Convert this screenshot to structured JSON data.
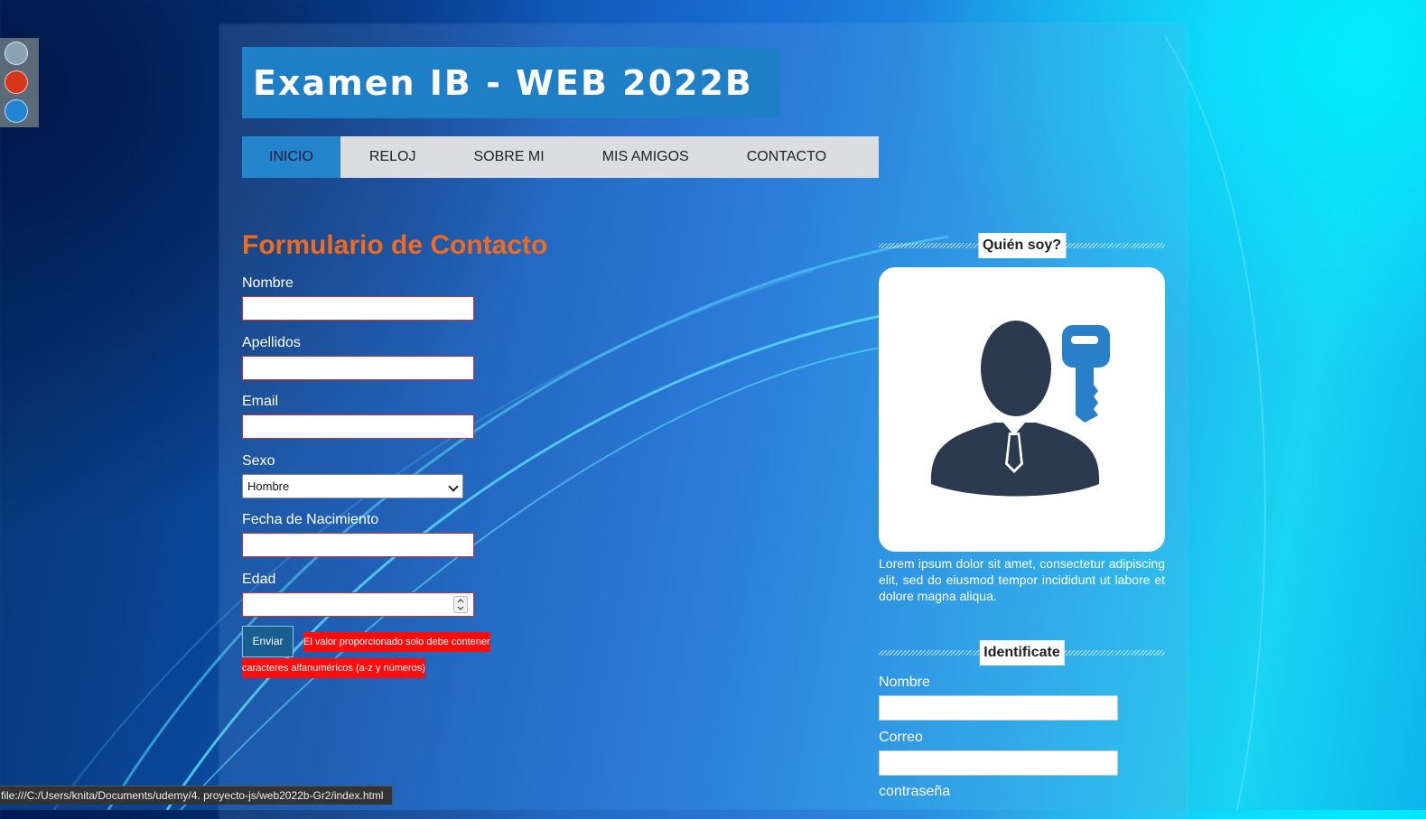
{
  "theme": {
    "dots": [
      {
        "name": "gray",
        "color": "#8aa4b6"
      },
      {
        "name": "red",
        "color": "#d6361a"
      },
      {
        "name": "blue",
        "color": "#2186d1"
      }
    ]
  },
  "header": {
    "title": "Examen IB - WEB 2022B"
  },
  "nav": {
    "items": [
      {
        "label": "INICIO",
        "active": true
      },
      {
        "label": "RELOJ",
        "active": false
      },
      {
        "label": "SOBRE MI",
        "active": false
      },
      {
        "label": "MIS AMIGOS",
        "active": false
      },
      {
        "label": "CONTACTO",
        "active": false
      }
    ]
  },
  "contact_form": {
    "title": "Formulario de Contacto",
    "nombre_label": "Nombre",
    "apellidos_label": "Apellidos",
    "email_label": "Email",
    "sexo_label": "Sexo",
    "sexo_selected": "Hombre",
    "fecha_label": "Fecha de Nacimiento",
    "edad_label": "Edad",
    "submit_label": "Enviar",
    "error_message": "El valor proporcionado solo debe contener caracteres alfanuméricos (a-z y números)"
  },
  "sidebar": {
    "about_heading": "Quién soy?",
    "bio": "Lorem ipsum dolor sit amet, consectetur adipiscing elit, sed do eiusmod tempor incididunt ut labore et dolore magna aliqua.",
    "login_heading": "Identificate",
    "nombre_label": "Nombre",
    "correo_label": "Correo",
    "password_label": "contraseña"
  },
  "colors": {
    "accent": "#1f7fc6",
    "title_orange": "#f26a1b",
    "error_red": "#ff0c0c",
    "avatar_dark": "#2b3a4e",
    "key_blue": "#2a7fc9"
  },
  "status": {
    "url": "file:///C:/Users/knita/Documents/udemy/4. proyecto-js/web2022b-Gr2/index.html"
  }
}
